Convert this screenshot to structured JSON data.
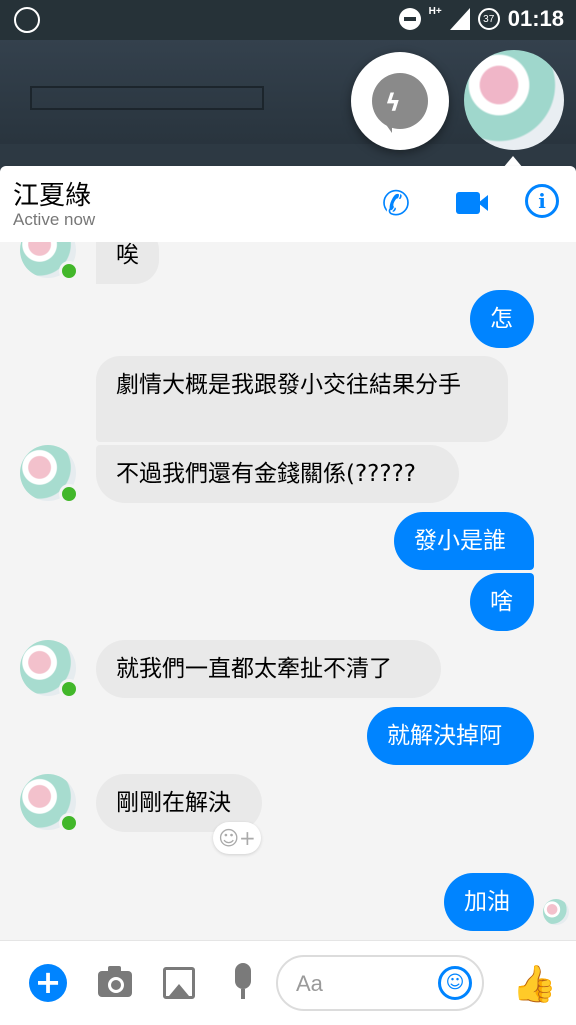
{
  "status_bar": {
    "network": "H+",
    "battery": "37",
    "time": "01:18"
  },
  "header": {
    "contact_name": "江夏綠",
    "status": "Active now"
  },
  "messages": [
    {
      "sender": "contact",
      "text": "唉"
    },
    {
      "sender": "me",
      "text": "怎"
    },
    {
      "sender": "contact",
      "text": "劇情大概是我跟發小交往結果分手"
    },
    {
      "sender": "contact",
      "text": "不過我們還有金錢關係(?????"
    },
    {
      "sender": "me",
      "text": "發小是誰"
    },
    {
      "sender": "me",
      "text": "啥"
    },
    {
      "sender": "contact",
      "text": "就我們一直都太牽扯不清了"
    },
    {
      "sender": "me",
      "text": "就解決掉阿"
    },
    {
      "sender": "contact",
      "text": "剛剛在解決"
    },
    {
      "sender": "me",
      "text": "加油"
    }
  ],
  "composer": {
    "placeholder": "Aa",
    "value": ""
  },
  "colors": {
    "accent": "#0084ff",
    "online": "#42b72a",
    "received_bubble": "#e9e9e9"
  }
}
